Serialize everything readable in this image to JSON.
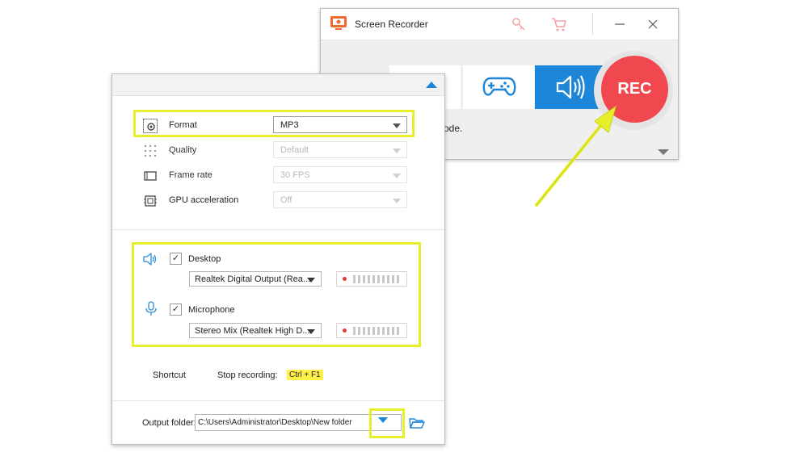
{
  "recorder": {
    "title": "Screen Recorder",
    "rec_label": "REC",
    "mode_text": "ode.",
    "icons": [
      "app-icon",
      "key-icon",
      "cart-icon",
      "minimize-icon",
      "close-icon",
      "gamepad-icon",
      "speaker-icon",
      "collapse-icon"
    ]
  },
  "settings": {
    "rows": [
      {
        "label": "Format",
        "value": "MP3",
        "icon": "gear-icon",
        "enabled": true
      },
      {
        "label": "Quality",
        "value": "Default",
        "icon": "quality-icon",
        "enabled": false
      },
      {
        "label": "Frame rate",
        "value": "30 FPS",
        "icon": "film-icon",
        "enabled": false
      },
      {
        "label": "GPU acceleration",
        "value": "Off",
        "icon": "chip-icon",
        "enabled": false
      }
    ],
    "audio": {
      "desktop": {
        "label": "Desktop",
        "checked": true,
        "device": "Realtek Digital Output (Rea..."
      },
      "microphone": {
        "label": "Microphone",
        "checked": true,
        "device": "Stereo Mix (Realtek High D..."
      }
    },
    "shortcut": {
      "label": "Shortcut",
      "stop_label": "Stop recording:",
      "stop_key": "Ctrl + F1"
    },
    "output": {
      "label": "Output folder:",
      "path": "C:\\Users\\Administrator\\Desktop\\New folder"
    }
  },
  "colors": {
    "accent": "#1e86d8",
    "rec": "#f1474e",
    "highlight": "#e6ef2a"
  }
}
